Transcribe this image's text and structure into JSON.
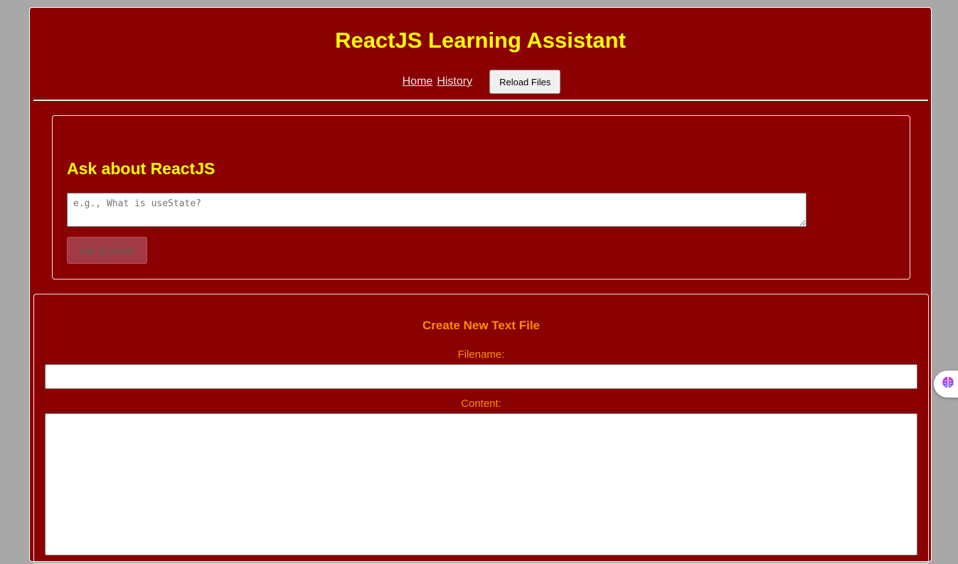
{
  "header": {
    "title": "ReactJS Learning Assistant",
    "nav": {
      "home_label": "Home",
      "history_label": "History"
    },
    "reload_label": "Reload Files"
  },
  "ask": {
    "heading": "Ask about ReactJS",
    "question_placeholder": "e.g., What is useState?",
    "question_value": "",
    "ask_button_label": "Ask Question",
    "ask_button_disabled": true
  },
  "create_file": {
    "heading": "Create New Text File",
    "filename_label": "Filename:",
    "filename_value": "",
    "content_label": "Content:",
    "content_value": ""
  },
  "extension": {
    "icon": "brain-icon"
  },
  "colors": {
    "page_background": "#a8a8a8",
    "panel_background": "#8b0000",
    "title_color": "#ffff00",
    "accent_orange": "#ff8c00",
    "disabled_button": "#a13a44"
  }
}
